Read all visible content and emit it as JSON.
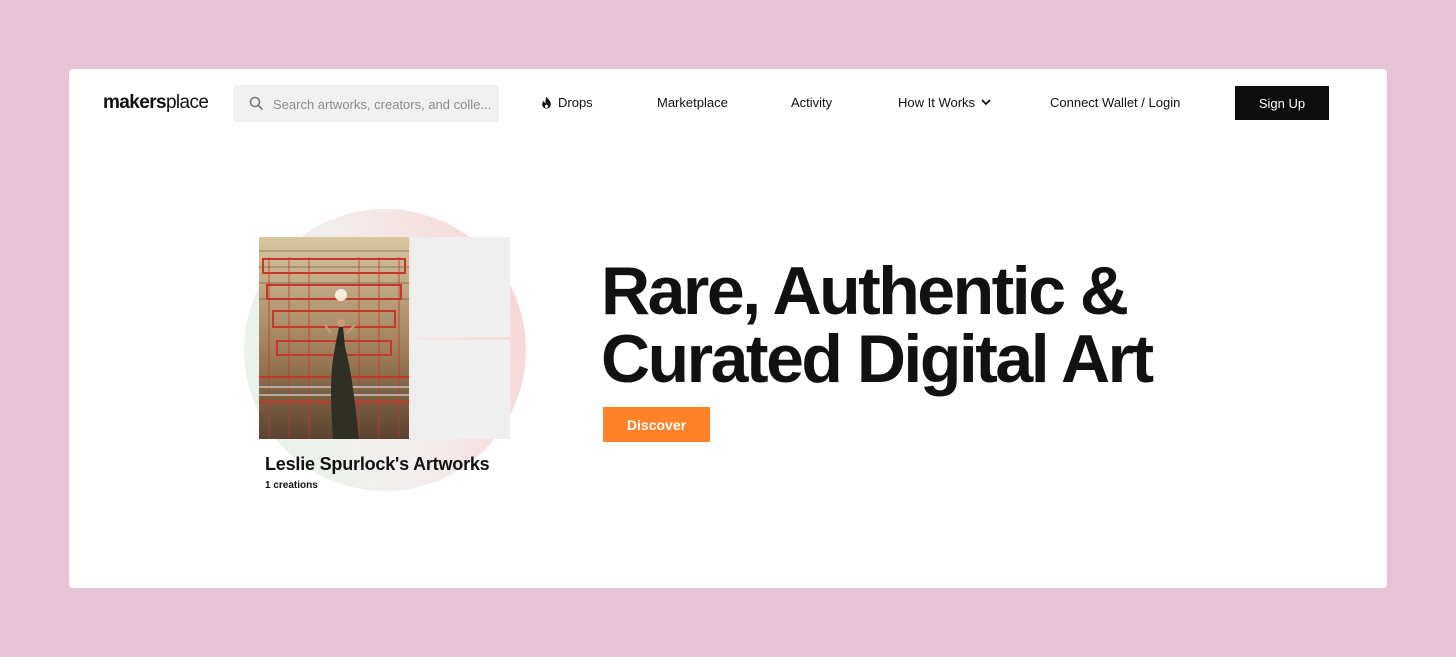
{
  "brand": {
    "logo_bold": "makers",
    "logo_light": "place"
  },
  "search": {
    "placeholder": "Search artworks, creators, and colle..."
  },
  "nav": {
    "drops": "Drops",
    "marketplace": "Marketplace",
    "activity": "Activity",
    "how_it_works": "How It Works",
    "connect": "Connect Wallet / Login",
    "signup": "Sign Up"
  },
  "featured": {
    "collection_name": "Leslie Spurlock's Artworks",
    "count": "1 creations"
  },
  "hero": {
    "headline_line1": "Rare, Authentic &",
    "headline_line2": "Curated Digital Art",
    "cta": "Discover"
  },
  "colors": {
    "page_background": "#e8c5d6",
    "cta_orange": "#ff8128",
    "signup_black": "#0d0d0d"
  },
  "icons": [
    "search-icon",
    "flame-icon",
    "chevron-down-icon"
  ]
}
